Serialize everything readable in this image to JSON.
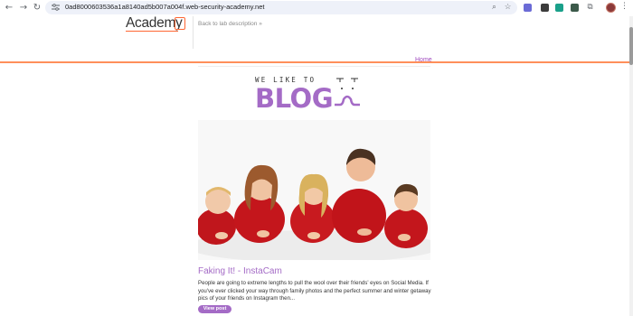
{
  "browser": {
    "url": "0ad8000603536a1a8140ad5b007a004f.web-security-academy.net"
  },
  "header": {
    "logo_text": "Academy",
    "back_link": "Back to lab description",
    "back_link_arrow": "»"
  },
  "nav": {
    "home_label": "Home"
  },
  "blog_logo": {
    "tagline": "WE LIKE TO",
    "word": "BLOG"
  },
  "post": {
    "title": "Faking It! - InstaCam",
    "summary": "People are going to extreme lengths to pull the wool over their friends' eyes on Social Media. If you've ever clicked your way through family photos and the perfect summer and winter getaway pics of your friends on Instagram then...",
    "view_label": "View post"
  },
  "colors": {
    "accent": "#a46bc6",
    "orange": "#ff8f5a"
  },
  "icons": [
    "back-arrow-icon",
    "forward-arrow-icon",
    "reload-icon",
    "site-info-icon",
    "zoom-icon",
    "bookmark-star-icon",
    "extension-icons",
    "puzzle-icon",
    "profile-avatar",
    "menu-icon"
  ]
}
